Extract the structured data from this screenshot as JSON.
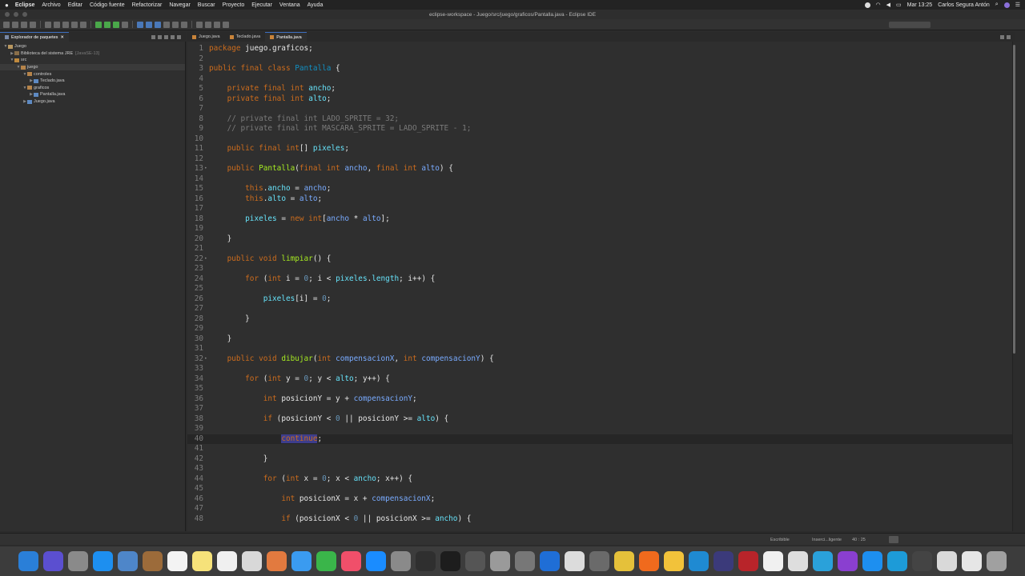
{
  "menubar": {
    "app_name": "Eclipse",
    "menus": [
      "Archivo",
      "Editar",
      "Código fuente",
      "Refactorizar",
      "Navegar",
      "Buscar",
      "Proyecto",
      "Ejecutar",
      "Ventana",
      "Ayuda"
    ],
    "clock": "Mar 13:25",
    "user": "Carlos Segura Antón"
  },
  "window": {
    "title": "eclipse-workspace - Juego/src/juego/graficos/Pantalla.java - Eclipse IDE"
  },
  "explorer": {
    "tab_label": "Explorador de paquetes",
    "tree": [
      {
        "label": "Juego",
        "indent": 0,
        "icon": "project-icon",
        "twisty": "▼"
      },
      {
        "label": "Biblioteca del sistema JRE",
        "note": "[JavaSE-13]",
        "indent": 1,
        "icon": "library-icon",
        "twisty": "▶"
      },
      {
        "label": "src",
        "indent": 1,
        "icon": "source-folder-icon",
        "twisty": "▼"
      },
      {
        "label": "juego",
        "indent": 2,
        "icon": "package-icon",
        "twisty": "▼"
      },
      {
        "label": "controles",
        "indent": 3,
        "icon": "package-icon",
        "twisty": "▼"
      },
      {
        "label": "Teclado.java",
        "indent": 4,
        "icon": "java-file-icon",
        "twisty": "▶"
      },
      {
        "label": "graficos",
        "indent": 3,
        "icon": "package-icon",
        "twisty": "▼"
      },
      {
        "label": "Pantalla.java",
        "indent": 4,
        "icon": "java-file-icon",
        "twisty": "▶"
      },
      {
        "label": "Juego.java",
        "indent": 3,
        "icon": "java-file-icon",
        "twisty": "▶"
      }
    ]
  },
  "editor": {
    "tabs": [
      {
        "label": "Juego.java",
        "active": false
      },
      {
        "label": "Teclado.java",
        "active": false
      },
      {
        "label": "Pantalla.java",
        "active": true
      }
    ],
    "current_line": 40,
    "lines": [
      {
        "n": "1",
        "t": [
          [
            "kw",
            "package "
          ],
          [
            "pkgname",
            "juego.graficos;"
          ]
        ]
      },
      {
        "n": "2",
        "t": []
      },
      {
        "n": "3",
        "t": [
          [
            "kw",
            "public final class "
          ],
          [
            "typ",
            "Pantalla"
          ],
          [
            "op",
            " {"
          ]
        ]
      },
      {
        "n": "4",
        "t": []
      },
      {
        "n": "5",
        "t": [
          [
            "op",
            "    "
          ],
          [
            "kw",
            "private final int "
          ],
          [
            "fld",
            "ancho"
          ],
          [
            "op",
            ";"
          ]
        ]
      },
      {
        "n": "6",
        "t": [
          [
            "op",
            "    "
          ],
          [
            "kw",
            "private final int "
          ],
          [
            "fld",
            "alto"
          ],
          [
            "op",
            ";"
          ]
        ]
      },
      {
        "n": "7",
        "t": []
      },
      {
        "n": "8",
        "t": [
          [
            "cmt",
            "    // private final int LADO_SPRITE = 32;"
          ]
        ]
      },
      {
        "n": "9",
        "t": [
          [
            "cmt",
            "    // private final int MASCARA_SPRITE = LADO_SPRITE - 1;"
          ]
        ]
      },
      {
        "n": "10",
        "t": []
      },
      {
        "n": "11",
        "t": [
          [
            "op",
            "    "
          ],
          [
            "kw",
            "public final int"
          ],
          [
            "op",
            "[] "
          ],
          [
            "fld",
            "pixeles"
          ],
          [
            "op",
            ";"
          ]
        ]
      },
      {
        "n": "12",
        "t": []
      },
      {
        "n": "13",
        "fold": "•",
        "t": [
          [
            "op",
            "    "
          ],
          [
            "kw",
            "public "
          ],
          [
            "mth",
            "Pantalla"
          ],
          [
            "op",
            "("
          ],
          [
            "kw",
            "final int "
          ],
          [
            "prm",
            "ancho"
          ],
          [
            "op",
            ", "
          ],
          [
            "kw",
            "final int "
          ],
          [
            "prm",
            "alto"
          ],
          [
            "op",
            ") {"
          ]
        ]
      },
      {
        "n": "14",
        "t": []
      },
      {
        "n": "15",
        "t": [
          [
            "op",
            "        "
          ],
          [
            "kw",
            "this"
          ],
          [
            "op",
            "."
          ],
          [
            "fld",
            "ancho"
          ],
          [
            "op",
            " = "
          ],
          [
            "prm",
            "ancho"
          ],
          [
            "op",
            ";"
          ]
        ]
      },
      {
        "n": "16",
        "t": [
          [
            "op",
            "        "
          ],
          [
            "kw",
            "this"
          ],
          [
            "op",
            "."
          ],
          [
            "fld",
            "alto"
          ],
          [
            "op",
            " = "
          ],
          [
            "prm",
            "alto"
          ],
          [
            "op",
            ";"
          ]
        ]
      },
      {
        "n": "17",
        "t": []
      },
      {
        "n": "18",
        "t": [
          [
            "op",
            "        "
          ],
          [
            "fld",
            "pixeles"
          ],
          [
            "op",
            " = "
          ],
          [
            "kw",
            "new int"
          ],
          [
            "op",
            "["
          ],
          [
            "prm",
            "ancho"
          ],
          [
            "op",
            " * "
          ],
          [
            "prm",
            "alto"
          ],
          [
            "op",
            "];"
          ]
        ]
      },
      {
        "n": "19",
        "t": []
      },
      {
        "n": "20",
        "t": [
          [
            "op",
            "    }"
          ]
        ]
      },
      {
        "n": "21",
        "t": []
      },
      {
        "n": "22",
        "fold": "•",
        "t": [
          [
            "op",
            "    "
          ],
          [
            "kw",
            "public void "
          ],
          [
            "mth",
            "limpiar"
          ],
          [
            "op",
            "() {"
          ]
        ]
      },
      {
        "n": "23",
        "t": []
      },
      {
        "n": "24",
        "t": [
          [
            "op",
            "        "
          ],
          [
            "kw",
            "for "
          ],
          [
            "op",
            "("
          ],
          [
            "kw",
            "int "
          ],
          [
            "op",
            "i = "
          ],
          [
            "num",
            "0"
          ],
          [
            "op",
            "; i < "
          ],
          [
            "fld",
            "pixeles"
          ],
          [
            "op",
            "."
          ],
          [
            "fld",
            "length"
          ],
          [
            "op",
            "; i++) {"
          ]
        ]
      },
      {
        "n": "25",
        "t": []
      },
      {
        "n": "26",
        "t": [
          [
            "op",
            "            "
          ],
          [
            "fld",
            "pixeles"
          ],
          [
            "op",
            "[i] = "
          ],
          [
            "num",
            "0"
          ],
          [
            "op",
            ";"
          ]
        ]
      },
      {
        "n": "27",
        "t": []
      },
      {
        "n": "28",
        "t": [
          [
            "op",
            "        }"
          ]
        ]
      },
      {
        "n": "29",
        "t": []
      },
      {
        "n": "30",
        "t": [
          [
            "op",
            "    }"
          ]
        ]
      },
      {
        "n": "31",
        "t": []
      },
      {
        "n": "32",
        "fold": "•",
        "t": [
          [
            "op",
            "    "
          ],
          [
            "kw",
            "public void "
          ],
          [
            "mth",
            "dibujar"
          ],
          [
            "op",
            "("
          ],
          [
            "kw",
            "int "
          ],
          [
            "prm",
            "compensacionX"
          ],
          [
            "op",
            ", "
          ],
          [
            "kw",
            "int "
          ],
          [
            "prm",
            "compensacionY"
          ],
          [
            "op",
            ") {"
          ]
        ]
      },
      {
        "n": "33",
        "t": []
      },
      {
        "n": "34",
        "t": [
          [
            "op",
            "        "
          ],
          [
            "kw",
            "for "
          ],
          [
            "op",
            "("
          ],
          [
            "kw",
            "int "
          ],
          [
            "op",
            "y = "
          ],
          [
            "num",
            "0"
          ],
          [
            "op",
            "; y < "
          ],
          [
            "fld",
            "alto"
          ],
          [
            "op",
            "; y++) {"
          ]
        ]
      },
      {
        "n": "35",
        "t": []
      },
      {
        "n": "36",
        "t": [
          [
            "op",
            "            "
          ],
          [
            "kw",
            "int "
          ],
          [
            "op",
            "posicionY = y + "
          ],
          [
            "prm",
            "compensacionY"
          ],
          [
            "op",
            ";"
          ]
        ]
      },
      {
        "n": "37",
        "t": []
      },
      {
        "n": "38",
        "t": [
          [
            "op",
            "            "
          ],
          [
            "kw",
            "if "
          ],
          [
            "op",
            "(posicionY < "
          ],
          [
            "num",
            "0"
          ],
          [
            "op",
            " || posicionY >= "
          ],
          [
            "fld",
            "alto"
          ],
          [
            "op",
            ") {"
          ]
        ]
      },
      {
        "n": "39",
        "t": []
      },
      {
        "n": "40",
        "t": [
          [
            "op",
            "                "
          ],
          [
            "hl",
            "continue"
          ],
          [
            "op",
            ";"
          ]
        ]
      },
      {
        "n": "41",
        "t": []
      },
      {
        "n": "42",
        "t": [
          [
            "op",
            "            }"
          ]
        ]
      },
      {
        "n": "43",
        "t": []
      },
      {
        "n": "44",
        "t": [
          [
            "op",
            "            "
          ],
          [
            "kw",
            "for "
          ],
          [
            "op",
            "("
          ],
          [
            "kw",
            "int "
          ],
          [
            "op",
            "x = "
          ],
          [
            "num",
            "0"
          ],
          [
            "op",
            "; x < "
          ],
          [
            "fld",
            "ancho"
          ],
          [
            "op",
            "; x++) {"
          ]
        ]
      },
      {
        "n": "45",
        "t": []
      },
      {
        "n": "46",
        "t": [
          [
            "op",
            "                "
          ],
          [
            "kw",
            "int "
          ],
          [
            "op",
            "posicionX = x + "
          ],
          [
            "prm",
            "compensacionX"
          ],
          [
            "op",
            ";"
          ]
        ]
      },
      {
        "n": "47",
        "t": []
      },
      {
        "n": "48",
        "t": [
          [
            "op",
            "                "
          ],
          [
            "kw",
            "if "
          ],
          [
            "op",
            "(posicionX < "
          ],
          [
            "num",
            "0"
          ],
          [
            "op",
            " || posicionX >= "
          ],
          [
            "fld",
            "ancho"
          ],
          [
            "op",
            ") {"
          ]
        ]
      }
    ]
  },
  "statusbar": {
    "mode": "Escribible",
    "insert": "Inserci...ligente",
    "position": "40 : 25"
  },
  "dock": {
    "icons": [
      {
        "name": "finder-icon",
        "color": "#2a7fd8"
      },
      {
        "name": "siri-icon",
        "color": "#5b4fd0"
      },
      {
        "name": "launchpad-icon",
        "color": "#8a8a8a"
      },
      {
        "name": "safari-icon",
        "color": "#1d8ff0"
      },
      {
        "name": "preview-icon",
        "color": "#4e86c9"
      },
      {
        "name": "notes-brown-icon",
        "color": "#9c6b3a"
      },
      {
        "name": "calendar-icon",
        "color": "#f3f3f3"
      },
      {
        "name": "notes-icon",
        "color": "#f6e27a"
      },
      {
        "name": "reminders-icon",
        "color": "#f0f0f0"
      },
      {
        "name": "photos-icon",
        "color": "#d8d8d8"
      },
      {
        "name": "photos-wheel-icon",
        "color": "#e27a3f"
      },
      {
        "name": "messages-icon",
        "color": "#3a9bf0"
      },
      {
        "name": "facetime-icon",
        "color": "#3ab54a"
      },
      {
        "name": "music-icon",
        "color": "#f04f6a"
      },
      {
        "name": "app-store-icon",
        "color": "#1a8cff"
      },
      {
        "name": "system-preferences-icon",
        "color": "#8a8a8a"
      },
      {
        "name": "activity-monitor-icon",
        "color": "#2f2f2f"
      },
      {
        "name": "terminal-icon",
        "color": "#1d1d1d"
      },
      {
        "name": "safari-dark-icon",
        "color": "#555555"
      },
      {
        "name": "archive-utility-icon",
        "color": "#9a9a9a"
      },
      {
        "name": "automator-icon",
        "color": "#777777"
      },
      {
        "name": "bluetooth-icon",
        "color": "#1f6ed6"
      },
      {
        "name": "screenshot-icon",
        "color": "#dcdcdc"
      },
      {
        "name": "grapher-icon",
        "color": "#6a6a6a"
      },
      {
        "name": "chrome-icon",
        "color": "#e5c13a"
      },
      {
        "name": "firefox-icon",
        "color": "#f06a1d"
      },
      {
        "name": "bulb-icon",
        "color": "#f2c23a"
      },
      {
        "name": "vscode-icon",
        "color": "#1f8ad2"
      },
      {
        "name": "eclipse-icon",
        "color": "#3b3a7a"
      },
      {
        "name": "filezilla-icon",
        "color": "#b8242a"
      },
      {
        "name": "document-icon",
        "color": "#f0f0f0"
      },
      {
        "name": "contacts-icon",
        "color": "#dedede"
      },
      {
        "name": "telegram-icon",
        "color": "#2aa1da"
      },
      {
        "name": "podcasts-icon",
        "color": "#8a3fd0"
      },
      {
        "name": "appstore-connect-icon",
        "color": "#1d8ff0"
      },
      {
        "name": "edge-icon",
        "color": "#1d9bd8"
      },
      {
        "name": "window-icon",
        "color": "#444444"
      },
      {
        "name": "keychain-icon",
        "color": "#d9d9d9"
      },
      {
        "name": "display-icon",
        "color": "#e6e6e6"
      },
      {
        "name": "trash-icon",
        "color": "#a0a0a0"
      }
    ]
  }
}
